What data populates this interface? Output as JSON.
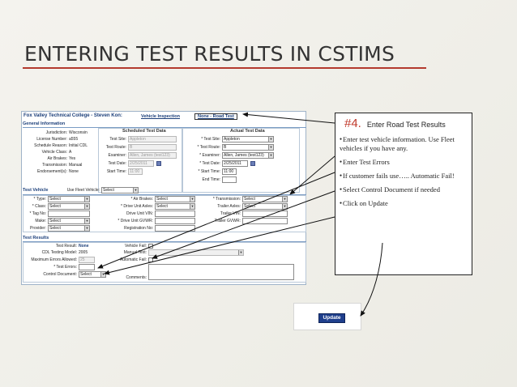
{
  "slide": {
    "title": "ENTERING TEST RESULTS IN CSTIMS"
  },
  "colors": {
    "accent": "#b33a2e",
    "link": "#1c3f7a",
    "step": "#c0392b",
    "button": "#1f3f8c"
  },
  "form": {
    "college": "Fox Valley Technical College - Steven Kon:",
    "nav_vehicle": "Vehicle Inspection",
    "nav_road": "None - Road Test",
    "general": {
      "title": "General Information",
      "rows": [
        {
          "label": "Jurisdiction:",
          "value": "Wisconsin"
        },
        {
          "label": "License Number:",
          "value": "a555"
        },
        {
          "label": "Schedule Reason:",
          "value": "Initial CDL"
        },
        {
          "label": "Vehicle Class:",
          "value": "A"
        },
        {
          "label": "Air Brakes:",
          "value": "Yes"
        },
        {
          "label": "Transmission:",
          "value": "Manual"
        },
        {
          "label": "Endorsement(s):",
          "value": "None"
        }
      ],
      "scheduled_header": "Scheduled Test Data",
      "actual_header": "Actual Test Data",
      "scheduled": [
        {
          "label": "Test Site:",
          "value": "Appleton"
        },
        {
          "label": "Test Route:",
          "value": "B"
        },
        {
          "label": "Examiner:",
          "value": "Allen, James (test123)"
        },
        {
          "label": "Test Date:",
          "value": "2/25/2011"
        },
        {
          "label": "Start Time:",
          "value": "11:00"
        }
      ],
      "actual": [
        {
          "label": "* Test Site:",
          "value": "Appleton"
        },
        {
          "label": "* Test Route:",
          "value": "B"
        },
        {
          "label": "* Examiner:",
          "value": "Allen, James (test123)"
        },
        {
          "label": "* Test Date:",
          "value": "2/25/2011"
        },
        {
          "label": "* Start Time:",
          "value": "11:00"
        },
        {
          "label": "End Time:",
          "value": ""
        }
      ]
    },
    "vehicle": {
      "title": "Test Vehicle",
      "use_fleet_label": "Use Fleet Vehicle:",
      "use_fleet_value": "Select",
      "col1": [
        {
          "label": "* Type:",
          "value": "Select"
        },
        {
          "label": "* Class:",
          "value": "Select"
        },
        {
          "label": "* Tag No:",
          "value": ""
        },
        {
          "label": "Make:",
          "value": "Select"
        },
        {
          "label": "Provider:",
          "value": "Select"
        }
      ],
      "col2": [
        {
          "label": "* Air Brakes:",
          "value": "Select"
        },
        {
          "label": "* Drive Unit Axles:",
          "value": "Select"
        },
        {
          "label": "Drive Unit VIN:",
          "value": ""
        },
        {
          "label": "* Drive Unit GVWR:",
          "value": ""
        },
        {
          "label": "Registration No:",
          "value": ""
        }
      ],
      "col3": [
        {
          "label": "* Transmission:",
          "value": "Select"
        },
        {
          "label": "Trailer Axles:",
          "value": "Select"
        },
        {
          "label": "Trailer VIN:",
          "value": ""
        },
        {
          "label": "Trailer GVWR:",
          "value": ""
        }
      ]
    },
    "results": {
      "title": "Test Results",
      "rows": [
        {
          "label": "Test Result:",
          "value": "None"
        },
        {
          "label": "CDL Testing Model:",
          "value": "2005"
        },
        {
          "label": "Maximum Errors Allowed:",
          "value": "25"
        },
        {
          "label": "* Test Errors:",
          "value": ""
        },
        {
          "label": "Control Document:",
          "value": "Select"
        }
      ],
      "vehicle_fail": "Vehicle Fail:",
      "manual_text": "Manual Text:",
      "automatic_fail": "Automatic Fail:",
      "comments": "Comments:"
    }
  },
  "callout": {
    "step": "#4.",
    "title": "Enter Road Test Results",
    "bullets": [
      "Enter test vehicle information. Use Fleet vehicles if you have any.",
      "Enter Test Errors",
      "If customer fails use….. Automatic Fail!",
      "Select Control Document if needed",
      "Click on Update"
    ]
  },
  "update_button": {
    "label": "Update"
  }
}
